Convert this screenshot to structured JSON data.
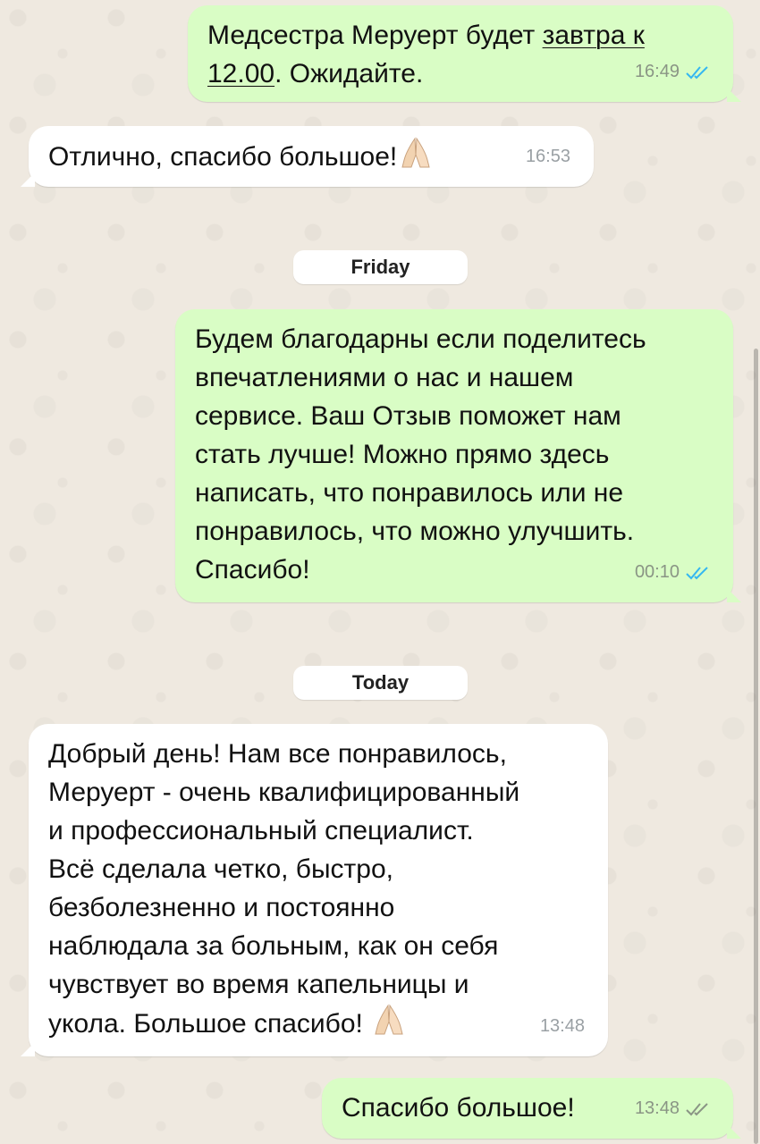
{
  "messages": [
    {
      "id": "m1",
      "direction": "outgoing",
      "text_before": "Медсестра Меруерт будет ",
      "text_link1": "завтра к",
      "text_link2": "12.00",
      "text_after": ". Ожидайте.",
      "time": "16:49",
      "status": "read"
    },
    {
      "id": "m2",
      "direction": "incoming",
      "text": "Отлично, спасибо большое!",
      "emoji": "folded-hands",
      "time": "16:53"
    },
    {
      "id": "m3",
      "direction": "outgoing",
      "text": "Будем благодарны если поделитесь\nвпечатлениями о нас и нашем\nсервисе. Ваш Отзыв поможет нам\nстать лучше! Можно прямо здесь\nнаписать, что понравилось или не\nпонравилось, что можно улучшить.\nСпасибо!",
      "time": "00:10",
      "status": "read"
    },
    {
      "id": "m4",
      "direction": "incoming",
      "text": "Добрый день! Нам все понравилось,\nМеруерт - очень квалифицированный\nи профессиональный специалист.\nВсё сделала четко, быстро,\nбезболезненно и постоянно\nнаблюдала за больным, как он себя\nчувствует во время капельницы и\nукола. Большое спасибо!",
      "emoji": "folded-hands",
      "time": "13:48"
    },
    {
      "id": "m5",
      "direction": "outgoing",
      "text": "Спасибо большое!",
      "time": "13:48",
      "status": "delivered"
    }
  ],
  "date_separators": {
    "friday": "Friday",
    "today": "Today"
  },
  "colors": {
    "outgoing_bubble": "#d9fdc5",
    "incoming_bubble": "#ffffff",
    "read_ticks": "#34b7f1",
    "delivered_ticks": "#8a9585",
    "background": "#efe9e0"
  }
}
